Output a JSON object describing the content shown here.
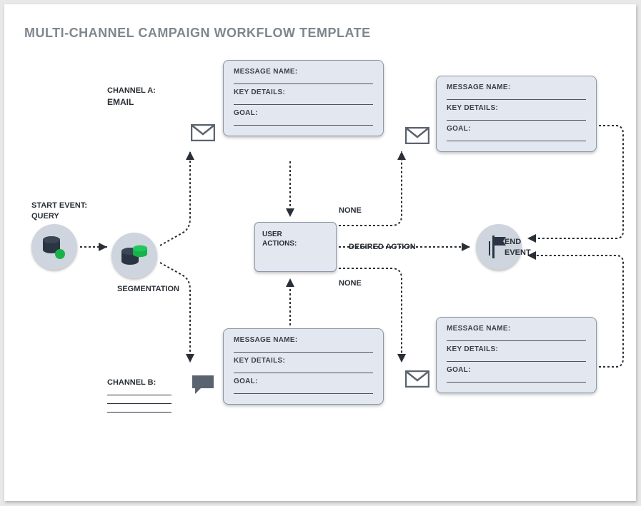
{
  "title": "MULTI-CHANNEL CAMPAIGN WORKFLOW TEMPLATE",
  "labels": {
    "channelA": "CHANNEL A:",
    "email": "EMAIL",
    "channelB": "CHANNEL B:",
    "startEvent": "START EVENT:",
    "query": "QUERY",
    "segmentation": "SEGMENTATION",
    "userActions": "USER\nACTIONS:",
    "none1": "NONE",
    "none2": "NONE",
    "desiredAction": "DESIRED ACTION",
    "endEvent": "END\nEVENT"
  },
  "fields": {
    "messageName": "MESSAGE NAME:",
    "keyDetails": "KEY DETAILS:",
    "goal": "GOAL:"
  }
}
